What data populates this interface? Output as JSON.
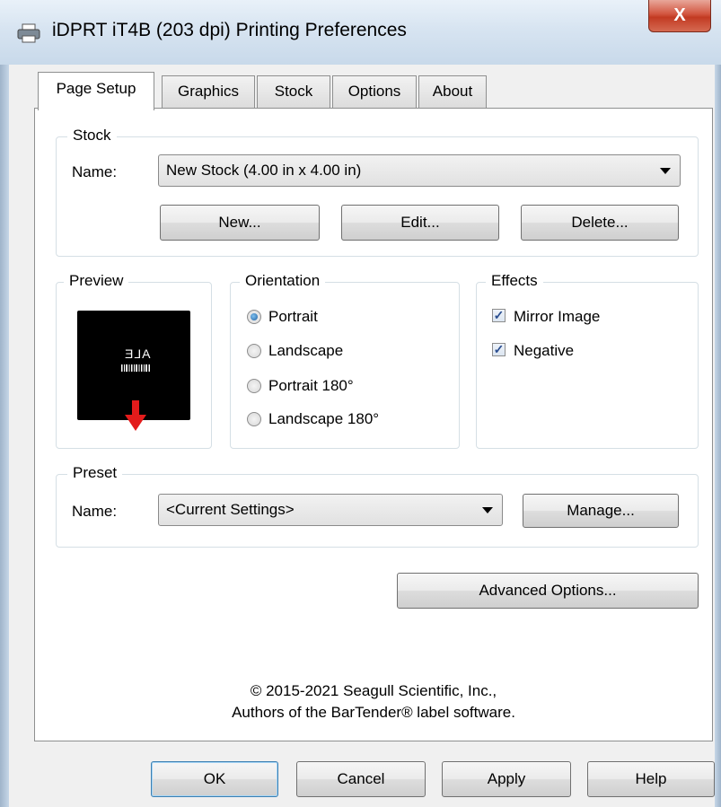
{
  "window": {
    "title": "iDPRT iT4B (203 dpi) Printing Preferences",
    "close_label": "X"
  },
  "tabs": [
    {
      "label": "Page Setup",
      "active": true
    },
    {
      "label": "Graphics"
    },
    {
      "label": "Stock"
    },
    {
      "label": "Options"
    },
    {
      "label": "About"
    }
  ],
  "stock": {
    "group_label": "Stock",
    "name_label": "Name:",
    "selected": "New Stock (4.00 in x 4.00 in)",
    "new_button": "New...",
    "edit_button": "Edit...",
    "delete_button": "Delete..."
  },
  "preview": {
    "group_label": "Preview",
    "sample_text": "ALE"
  },
  "orientation": {
    "group_label": "Orientation",
    "options": [
      "Portrait",
      "Landscape",
      "Portrait 180°",
      "Landscape 180°"
    ],
    "selected": "Portrait"
  },
  "effects": {
    "group_label": "Effects",
    "mirror_image": {
      "label": "Mirror Image",
      "checked": true
    },
    "negative": {
      "label": "Negative",
      "checked": true
    }
  },
  "preset": {
    "group_label": "Preset",
    "name_label": "Name:",
    "selected": "<Current Settings>",
    "manage_button": "Manage..."
  },
  "advanced_button": "Advanced Options...",
  "copyright": {
    "line1": "© 2015-2021 Seagull Scientific, Inc.,",
    "line2": "Authors of the BarTender® label software."
  },
  "footer": {
    "ok": "OK",
    "cancel": "Cancel",
    "apply": "Apply",
    "help": "Help"
  },
  "colors": {
    "close_button": "#c23a22",
    "accent": "#1f5e9f",
    "preview_background": "#000000",
    "preview_arrow": "#e31b1b"
  }
}
